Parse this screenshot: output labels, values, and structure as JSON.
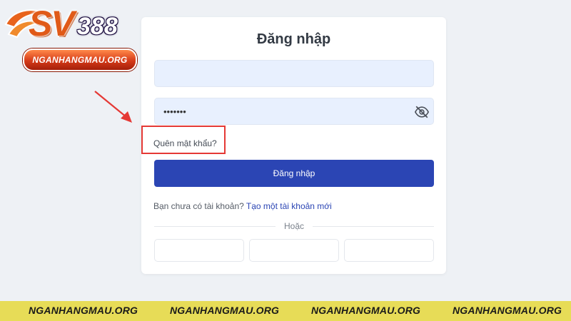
{
  "logo": {
    "brand_main": "SV",
    "brand_number": "388",
    "site": "NGANHANGMAU.ORG"
  },
  "login": {
    "title": "Đăng nhập",
    "username_value": "",
    "password_value": "•••••••",
    "forgot_label": "Quên mật khẩu?",
    "submit_label": "Đăng nhập",
    "no_account_text": "Bạn chưa có tài khoản?",
    "create_account_link": "Tạo một tài khoản mới",
    "or_label": "Hoặc"
  },
  "icons": {
    "password_toggle": "eye-slash-icon",
    "annotation": "red-arrow-icon"
  },
  "colors": {
    "primary": "#2b45b4",
    "annotation": "#e53935",
    "footer": "#e7dc57",
    "input_bg": "#e8f0fe"
  },
  "footer": {
    "items": [
      "NGANHANGMAU.ORG",
      "NGANHANGMAU.ORG",
      "NGANHANGMAU.ORG",
      "NGANHANGMAU.ORG"
    ]
  }
}
